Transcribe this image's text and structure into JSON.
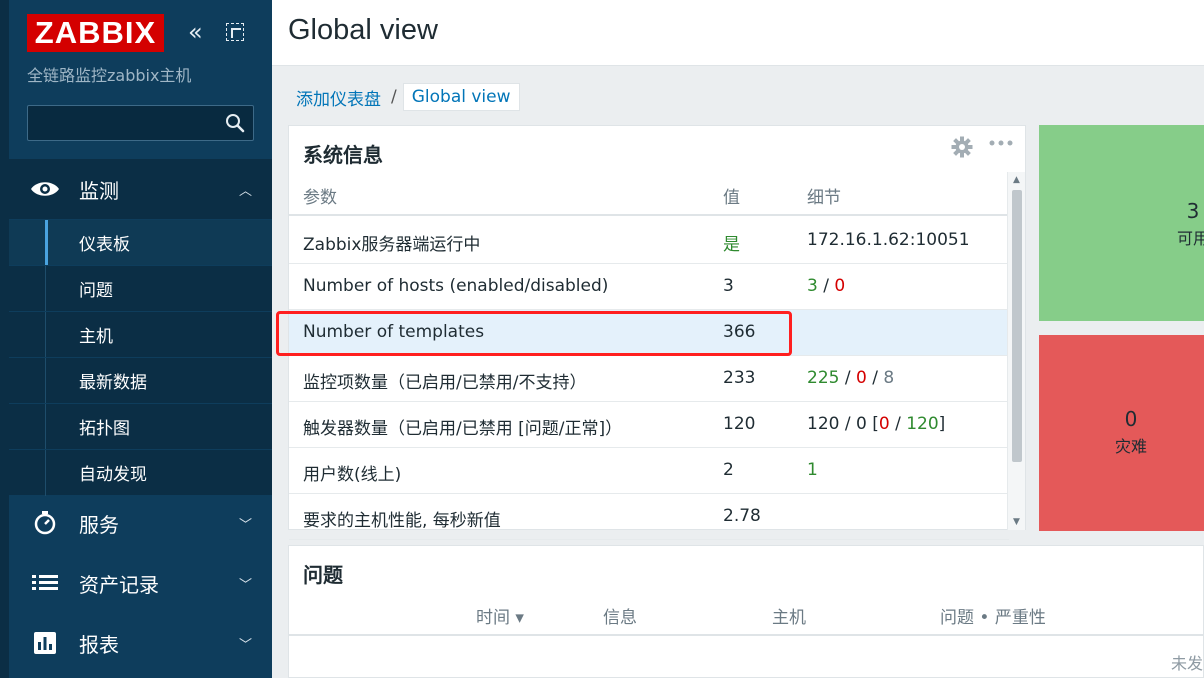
{
  "sidebar": {
    "logo_text": "ZABBIX",
    "server_name": "全链路监控zabbix主机",
    "search_placeholder": "",
    "menu": {
      "monitor": {
        "label": "监测",
        "items": [
          "仪表板",
          "问题",
          "主机",
          "最新数据",
          "拓扑图",
          "自动发现"
        ]
      },
      "services": {
        "label": "服务"
      },
      "inventory": {
        "label": "资产记录"
      },
      "reports": {
        "label": "报表"
      }
    }
  },
  "header": {
    "title": "Global view"
  },
  "breadcrumb": {
    "link": "添加仪表盘",
    "separator": "/",
    "current": "Global view"
  },
  "system_info": {
    "title": "系统信息",
    "columns": {
      "param": "参数",
      "value": "值",
      "details": "细节"
    },
    "rows": [
      {
        "param": "Zabbix服务器端运行中",
        "value": "是",
        "details": "172.16.1.62:10051"
      },
      {
        "param": "Number of hosts (enabled/disabled)",
        "value": "3",
        "d1": "3",
        "sep1": " / ",
        "d2": "0"
      },
      {
        "param": "Number of templates",
        "value": "366"
      },
      {
        "param": "监控项数量（已启用/已禁用/不支持）",
        "value": "233",
        "d1": "225",
        "sep1": " / ",
        "d2": "0",
        "sep2": " / ",
        "d3": "8"
      },
      {
        "param": "触发器数量（已启用/已禁用 [问题/正常]）",
        "value": "120",
        "d_prefix": "120 / 0 [",
        "d2": "0",
        "sep2": " / ",
        "d3": "120",
        "d_suffix": "]"
      },
      {
        "param": "用户数(线上)",
        "value": "2",
        "d1": "1"
      },
      {
        "param": "要求的主机性能, 每秒新值",
        "value": "2.78"
      }
    ]
  },
  "host_availability": {
    "available": {
      "count": "3",
      "label": "可用",
      "color": "#86cd89"
    },
    "disaster": {
      "count": "0",
      "label": "灾难",
      "color": "#e45959"
    }
  },
  "problems": {
    "title": "问题",
    "columns": {
      "time": "时间 ▾",
      "info": "信息",
      "host": "主机",
      "problem": "问题 • 严重性"
    },
    "no_data": "未发"
  },
  "colors": {
    "accent": "#0275b8",
    "sidebar": "#0e3d5c",
    "logo": "#d40000",
    "ok": "#2f8a2f",
    "problem": "#d40000",
    "highlight": "#ff1f1f"
  }
}
